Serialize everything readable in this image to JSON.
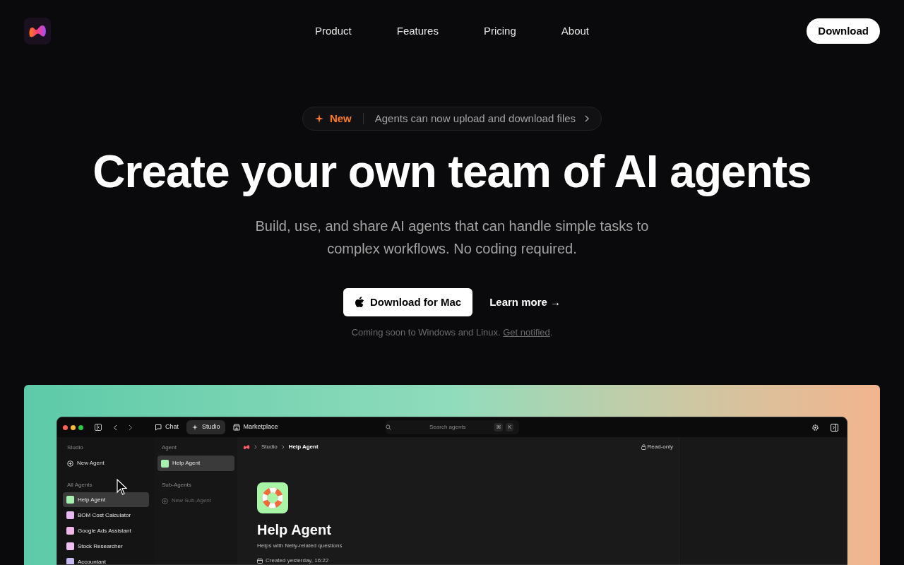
{
  "nav": {
    "links": [
      {
        "label": "Product"
      },
      {
        "label": "Features"
      },
      {
        "label": "Pricing"
      },
      {
        "label": "About"
      }
    ],
    "download_button": "Download"
  },
  "announcement": {
    "badge": "New",
    "text": "Agents can now upload and download files"
  },
  "hero": {
    "title": "Create your own team of AI agents",
    "subtitle": "Build, use, and share AI agents that can handle simple tasks to complex workflows. No coding required.",
    "primary_button": "Download for Mac",
    "secondary_button": "Learn more →",
    "note": {
      "text": "Coming soon to Windows and Linux.",
      "link": "Get notified",
      "end": "."
    }
  },
  "app": {
    "tabs": [
      {
        "label": "Chat",
        "selected": false
      },
      {
        "label": "Studio",
        "selected": true
      },
      {
        "label": "Marketplace",
        "selected": false
      }
    ],
    "search": {
      "placeholder": "Search agents",
      "keys": [
        "⌘",
        "K"
      ]
    },
    "sidebar": {
      "heading": "Studio",
      "new_button": "New Agent",
      "section": "All Agents",
      "items": [
        {
          "label": "Help Agent",
          "selected": true,
          "color": "#a8f0b0"
        },
        {
          "label": "BOM Cost Calculator",
          "selected": false,
          "color": "#e8b8f0"
        },
        {
          "label": "Google Ads Assistant",
          "selected": false,
          "color": "#f0b8e8"
        },
        {
          "label": "Stock Researcher",
          "selected": false,
          "color": "#f0c0f0"
        },
        {
          "label": "Accountant",
          "selected": false,
          "color": "#c8b8f0"
        }
      ]
    },
    "agent_panel": {
      "heading": "Agent",
      "item": {
        "label": "Help Agent",
        "selected": true
      },
      "sub_heading": "Sub-Agents",
      "new_button": "New Sub-Agent"
    },
    "breadcrumb": [
      "Studio",
      "Help Agent"
    ],
    "read_only": "Read-only",
    "agent": {
      "name": "Help Agent",
      "description": "Helps with Nelly-related questions",
      "created": "Created yesterday, 16:22"
    }
  }
}
